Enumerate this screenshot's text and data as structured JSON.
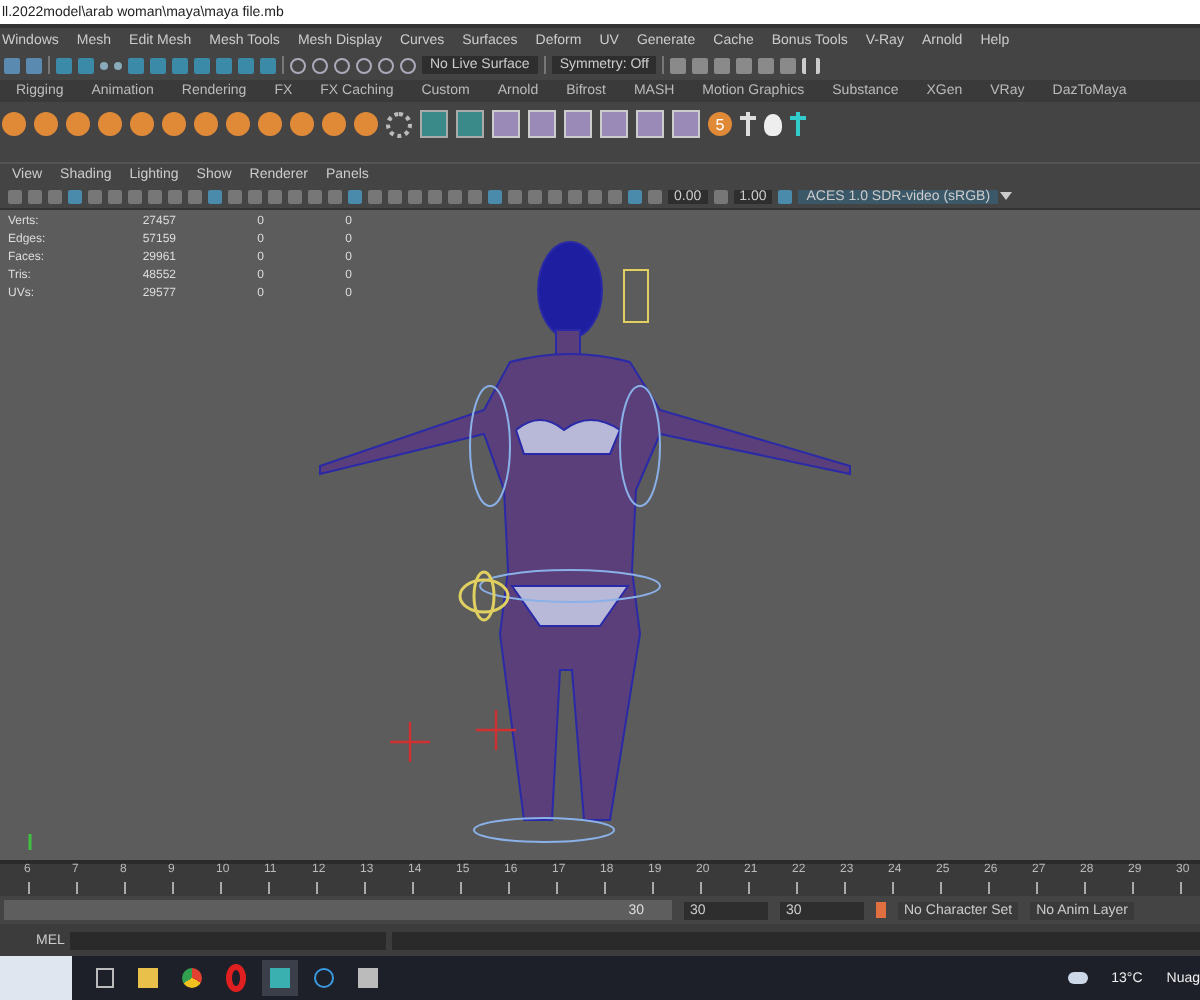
{
  "window": {
    "title": "ll.2022model\\arab woman\\maya\\maya file.mb"
  },
  "menu": [
    "Windows",
    "Mesh",
    "Edit Mesh",
    "Mesh Tools",
    "Mesh Display",
    "Curves",
    "Surfaces",
    "Deform",
    "UV",
    "Generate",
    "Cache",
    "Bonus Tools",
    "V-Ray",
    "Arnold",
    "Help"
  ],
  "status_line": {
    "live_surface": "No Live Surface",
    "symmetry": "Symmetry: Off"
  },
  "shelf_tabs": [
    {
      "label": "Rigging",
      "selected": false
    },
    {
      "label": "Animation",
      "selected": false
    },
    {
      "label": "Rendering",
      "selected": false
    },
    {
      "label": "FX",
      "selected": false
    },
    {
      "label": "FX Caching",
      "selected": false
    },
    {
      "label": "Custom",
      "selected": false
    },
    {
      "label": "Arnold",
      "selected": false
    },
    {
      "label": "Bifrost",
      "selected": false
    },
    {
      "label": "MASH",
      "selected": false
    },
    {
      "label": "Motion Graphics",
      "selected": false
    },
    {
      "label": "Substance",
      "selected": false
    },
    {
      "label": "XGen",
      "selected": false
    },
    {
      "label": "VRay",
      "selected": false
    },
    {
      "label": "DazToMaya",
      "selected": false
    }
  ],
  "shelf_badge": "5",
  "panel_menu": [
    "View",
    "Shading",
    "Lighting",
    "Show",
    "Renderer",
    "Panels"
  ],
  "panel_toolbar": {
    "exposure": "0.00",
    "gamma": "1.00",
    "color_space": "ACES 1.0 SDR-video (sRGB)"
  },
  "heads_up": [
    {
      "label": "Verts:",
      "values": [
        "27457",
        "0",
        "0"
      ]
    },
    {
      "label": "Edges:",
      "values": [
        "57159",
        "0",
        "0"
      ]
    },
    {
      "label": "Faces:",
      "values": [
        "29961",
        "0",
        "0"
      ]
    },
    {
      "label": "Tris:",
      "values": [
        "48552",
        "0",
        "0"
      ]
    },
    {
      "label": "UVs:",
      "values": [
        "29577",
        "0",
        "0"
      ]
    }
  ],
  "timeline": {
    "ticks": [
      "6",
      "7",
      "8",
      "9",
      "10",
      "11",
      "12",
      "13",
      "14",
      "15",
      "16",
      "17",
      "18",
      "19",
      "20",
      "21",
      "22",
      "23",
      "24",
      "25",
      "26",
      "27",
      "28",
      "29",
      "30"
    ]
  },
  "range": {
    "level": 1,
    "end_slider": "30",
    "playback_end": "30",
    "animation_end": "30",
    "character_set": "No Character Set",
    "anim_layer": "No Anim Layer"
  },
  "command_line": {
    "language": "MEL"
  },
  "taskbar": {
    "temperature": "13°C",
    "weather": "Nuag"
  }
}
